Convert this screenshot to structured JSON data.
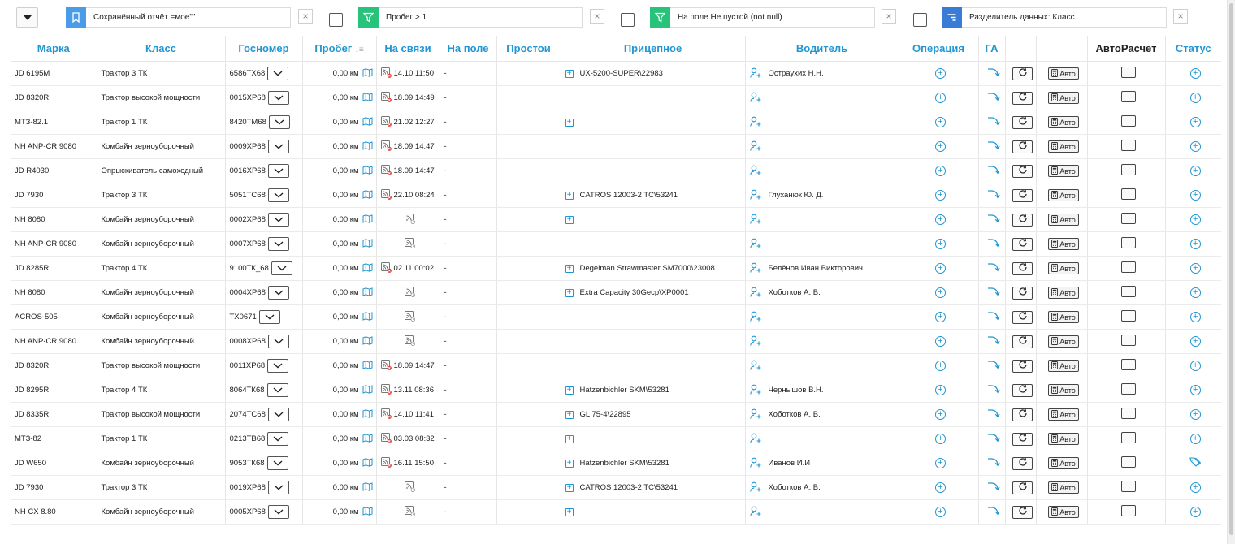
{
  "filters": [
    {
      "label": "Сохранённый отчёт =мое\"\"",
      "icon": "bookmark-icon",
      "color": "#4a9be8"
    },
    {
      "label": "Пробег > 1",
      "icon": "funnel-icon",
      "color": "#27c37a"
    },
    {
      "label": "На поле Не пустой (not null)",
      "icon": "funnel-icon",
      "color": "#27c37a"
    },
    {
      "label": "Разделитель данных: Класс",
      "icon": "list-icon",
      "color": "#3a7bd5"
    }
  ],
  "close_glyph": "×",
  "columns": {
    "brand": "Марка",
    "class": "Класс",
    "plate": "Госномер",
    "mileage": "Пробег",
    "mileage_sort": "↓≡",
    "online": "На связи",
    "in_field": "На поле",
    "idle": "Простои",
    "trailer": "Прицепное",
    "driver": "Водитель",
    "operation": "Операция",
    "ga": "ГА",
    "autocalc": "АвтоРасчет",
    "status": "Статус"
  },
  "auto_label": "Авто",
  "colors": {
    "accent": "#2196d3",
    "offline_badge": "#e53935"
  },
  "rows": [
    {
      "brand": "JD 6195M",
      "class": "Трактор 3 ТК",
      "plate": "6586ТХ68",
      "mileage": "0,00 км",
      "online": "14.10 11:50",
      "in_field": "-",
      "trailer": "UX-5200-SUPER\\22983",
      "driver": "Остраухих Н.Н.",
      "status": "plus"
    },
    {
      "brand": "JD 8320R",
      "class": "Трактор высокой мощности",
      "plate": "0015ХР68",
      "mileage": "0,00 км",
      "online": "18.09 14:49",
      "in_field": "-",
      "trailer": null,
      "driver": "",
      "status": "plus"
    },
    {
      "brand": "МТЗ-82.1",
      "class": "Трактор 1 ТК",
      "plate": "8420ТМ68",
      "mileage": "0,00 км",
      "online": "21.02 12:27",
      "in_field": "-",
      "trailer": "",
      "driver": "",
      "status": "plus"
    },
    {
      "brand": "NH ANP-CR 9080",
      "class": "Комбайн зерноуборочный",
      "plate": "0009ХР68",
      "mileage": "0,00 км",
      "online": "18.09 14:47",
      "in_field": "-",
      "trailer": null,
      "driver": "",
      "status": "plus"
    },
    {
      "brand": "JD R4030",
      "class": "Опрыскиватель самоходный",
      "plate": "0016ХР68",
      "mileage": "0,00 км",
      "online": "18.09 14:47",
      "in_field": "-",
      "trailer": null,
      "driver": "",
      "status": "plus"
    },
    {
      "brand": "JD 7930",
      "class": "Трактор 3 ТК",
      "plate": "5051ТС68",
      "mileage": "0,00 км",
      "online": "22.10 08:24",
      "in_field": "-",
      "trailer": "CATROS 12003-2 TC\\53241",
      "driver": "Глуханюк Ю. Д.",
      "status": "plus"
    },
    {
      "brand": "NH 8080",
      "class": "Комбайн зерноуборочный",
      "plate": "0002ХР68",
      "mileage": "0,00 км",
      "online": "",
      "in_field": "-",
      "trailer": "",
      "driver": "",
      "status": "plus"
    },
    {
      "brand": "NH ANP-CR 9080",
      "class": "Комбайн зерноуборочный",
      "plate": "0007ХР68",
      "mileage": "0,00 км",
      "online": "",
      "in_field": "-",
      "trailer": null,
      "driver": "",
      "status": "plus"
    },
    {
      "brand": "JD 8285R",
      "class": "Трактор 4 ТК",
      "plate": "9100ТК_68",
      "mileage": "0,00 км",
      "online": "02.11 00:02",
      "in_field": "-",
      "trailer": "Degelman Strawmaster SM7000\\23008",
      "driver": "Белёнов Иван Викторович",
      "status": "plus"
    },
    {
      "brand": "NH 8080",
      "class": "Комбайн зерноуборочный",
      "plate": "0004ХР68",
      "mileage": "0,00 км",
      "online": "",
      "in_field": "-",
      "trailer": "Extra Capacity 30Gecp\\XP0001",
      "driver": "Хоботков А. В.",
      "status": "plus"
    },
    {
      "brand": "ACROS-505",
      "class": "Комбайн зерноуборочный",
      "plate": "ТХ0671",
      "mileage": "0,00 км",
      "online": "",
      "in_field": "-",
      "trailer": null,
      "driver": "",
      "status": "plus"
    },
    {
      "brand": "NH ANP-CR 9080",
      "class": "Комбайн зерноуборочный",
      "plate": "0008ХР68",
      "mileage": "0,00 км",
      "online": "",
      "in_field": "-",
      "trailer": null,
      "driver": "",
      "status": "plus"
    },
    {
      "brand": "JD 8320R",
      "class": "Трактор высокой мощности",
      "plate": "0011ХР68",
      "mileage": "0,00 км",
      "online": "18.09 14:47",
      "in_field": "-",
      "trailer": null,
      "driver": "",
      "status": "plus"
    },
    {
      "brand": "JD 8295R",
      "class": "Трактор 4 ТК",
      "plate": "8064ТК68",
      "mileage": "0,00 км",
      "online": "13.11 08:36",
      "in_field": "-",
      "trailer": "Hatzenbichler SKM\\53281",
      "driver": "Чернышов В.Н.",
      "status": "plus"
    },
    {
      "brand": "JD 8335R",
      "class": "Трактор высокой мощности",
      "plate": "2074ТС68",
      "mileage": "0,00 км",
      "online": "14.10 11:41",
      "in_field": "-",
      "trailer": "GL 75-4\\22895",
      "driver": "Хоботков А. В.",
      "status": "plus"
    },
    {
      "brand": "МТЗ-82",
      "class": "Трактор 1 ТК",
      "plate": "0213ТВ68",
      "mileage": "0,00 км",
      "online": "03.03 08:32",
      "in_field": "-",
      "trailer": "",
      "driver": "",
      "status": "plus"
    },
    {
      "brand": "JD W650",
      "class": "Комбайн зерноуборочный",
      "plate": "9053ТК68",
      "mileage": "0,00 км",
      "online": "16.11 15:50",
      "in_field": "-",
      "trailer": "Hatzenbichler SKM\\53281",
      "driver": "Иванов И.И",
      "status": "tag"
    },
    {
      "brand": "JD 7930",
      "class": "Трактор 3 ТК",
      "plate": "0019ХР68",
      "mileage": "0,00 км",
      "online": "",
      "in_field": "-",
      "trailer": "CATROS 12003-2 TC\\53241",
      "driver": "Хоботков А. В.",
      "status": "plus"
    },
    {
      "brand": "NH CX 8.80",
      "class": "Комбайн зерноуборочный",
      "plate": "0005ХР68",
      "mileage": "0,00 км",
      "online": "",
      "in_field": "-",
      "trailer": "",
      "driver": "",
      "status": "plus"
    }
  ]
}
